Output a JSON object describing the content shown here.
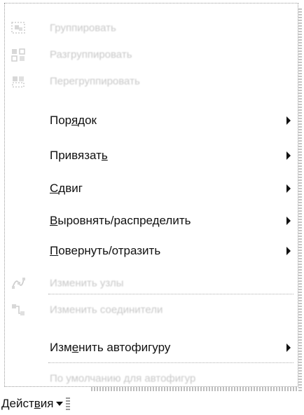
{
  "menu": {
    "disabled_items": {
      "group": "Группировать",
      "ungroup": "Разгруппировать",
      "regroup": "Перегруппировать",
      "edit_points": "Изменить узлы",
      "reroute": "Изменить соединители",
      "set_default": "По умолчанию для автофигур"
    },
    "order": {
      "pre": "Пор",
      "key": "я",
      "post": "док"
    },
    "snap": {
      "pre": "Привязат",
      "key": "ь",
      "post": ""
    },
    "nudge": {
      "pre": "",
      "key": "С",
      "post": "двиг"
    },
    "align": {
      "pre": "",
      "key": "В",
      "post": "ыровнять/распределить"
    },
    "rotate": {
      "pre": "",
      "key": "П",
      "post": "овернуть/отразить"
    },
    "change_shape": {
      "pre": "Изм",
      "key": "е",
      "post": "нить автофигуру"
    }
  },
  "actions_button": {
    "pre": "Дейст",
    "key": "в",
    "post": "ия"
  }
}
